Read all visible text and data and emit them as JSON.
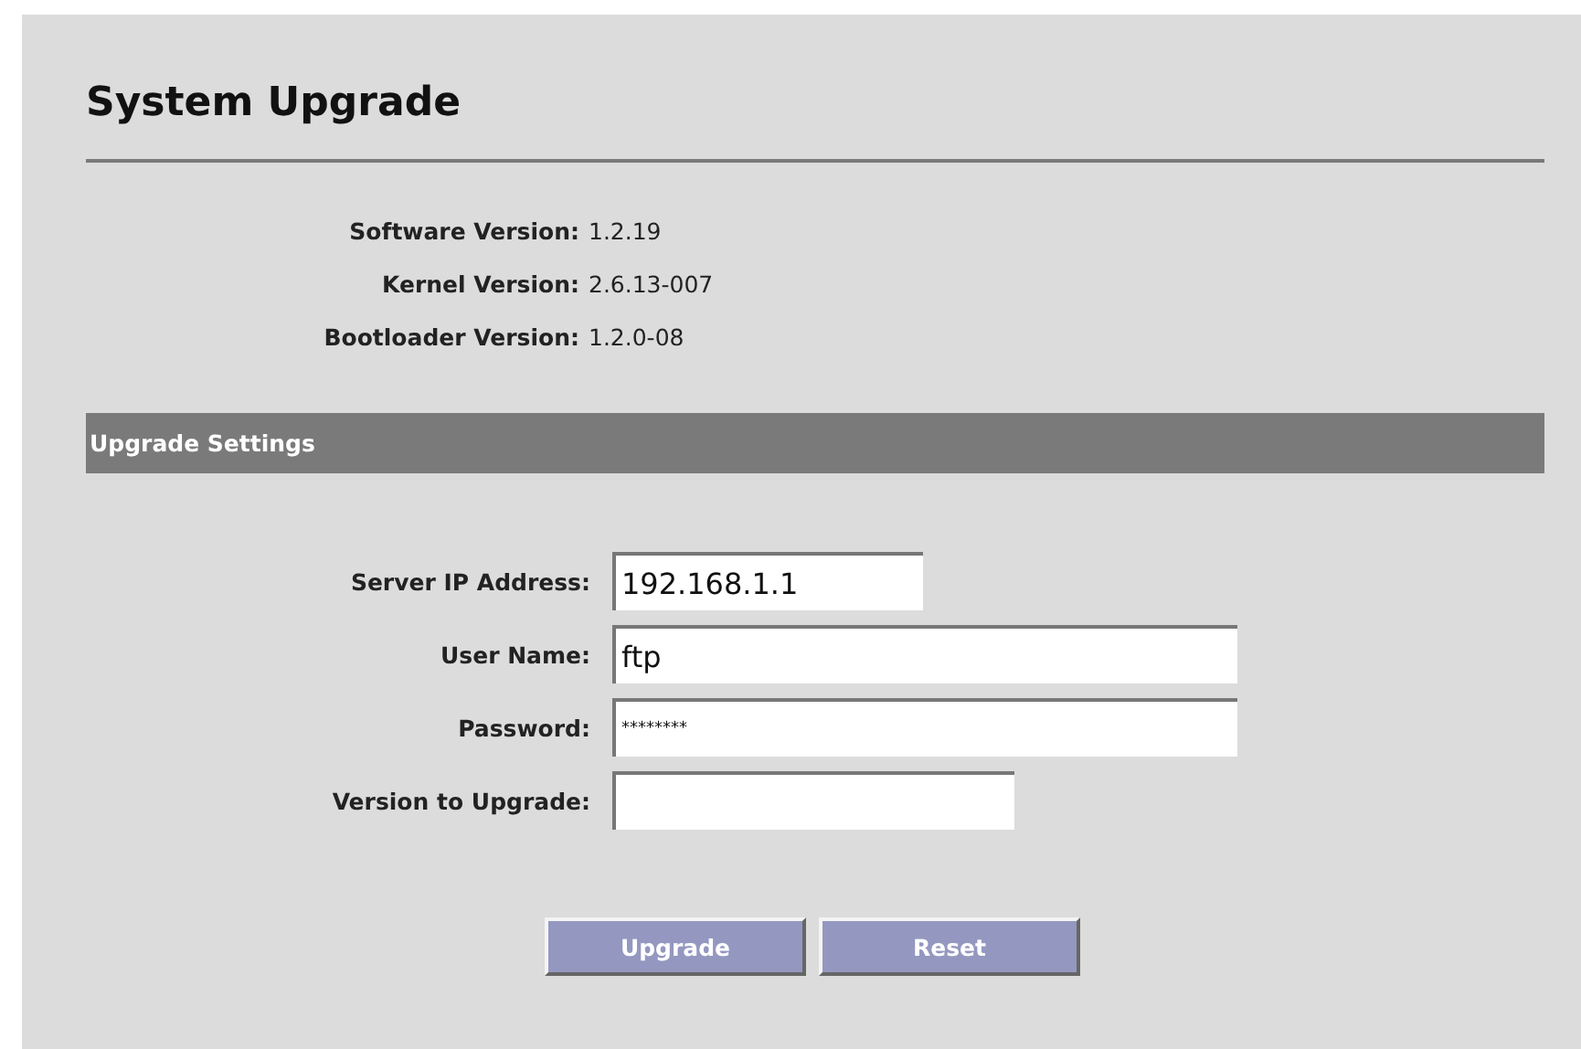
{
  "title": "System Upgrade",
  "versions": [
    {
      "label": "Software Version:",
      "value": "1.2.19"
    },
    {
      "label": "Kernel Version:",
      "value": "2.6.13-007"
    },
    {
      "label": "Bootloader Version:",
      "value": "1.2.0-08"
    }
  ],
  "section": "Upgrade Settings",
  "fields": [
    {
      "label": "Server IP Address:",
      "value": "192.168.1.1"
    },
    {
      "label": "User Name:",
      "value": "ftp"
    },
    {
      "label": "Password:",
      "value": "********",
      "kind": "masked"
    },
    {
      "label": "Version to Upgrade:"
    }
  ],
  "buttons": [
    "Upgrade",
    "Reset"
  ]
}
